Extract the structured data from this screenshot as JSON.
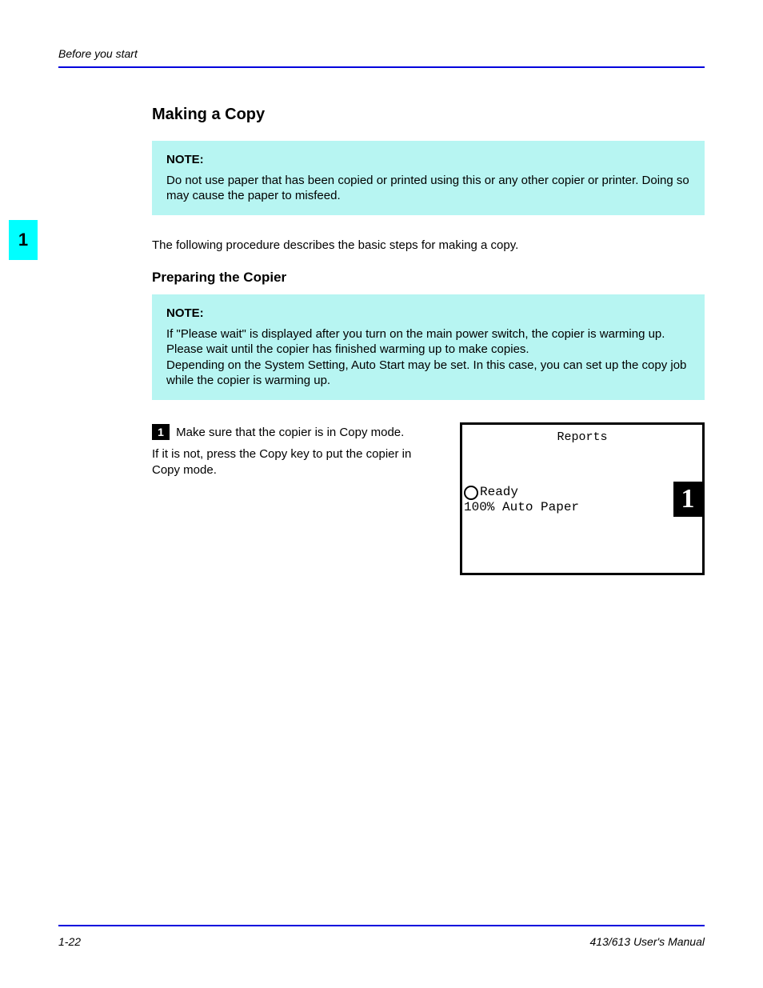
{
  "header": {
    "section_label": "Before you start"
  },
  "side_tab": {
    "label": "1"
  },
  "main": {
    "title": "Making a Copy",
    "note1": {
      "title": "NOTE:",
      "body": "Do not use paper that has been copied or printed using this or any other copier or printer. Doing so may cause the paper to misfeed."
    },
    "intro": "The following procedure describes the basic steps for making a copy.",
    "subtitle": "Preparing the Copier",
    "note2": {
      "title": "NOTE:",
      "body_a": "If \"Please wait\" is displayed after you turn on the main power switch, the copier is warming up. Please wait until the copier has finished warming up to make copies.",
      "body_b": "Depending on the System Setting, Auto Start may be set. In this case, you can set up the copy job while the copier is warming up."
    },
    "step": {
      "num": "1",
      "text_a": "Make sure that the copier is in Copy mode.",
      "text_b": "If it is not, press the Copy key to put the copier in Copy mode."
    },
    "display": {
      "report_title": "Reports",
      "status_line1": "Ready",
      "status_line2": "100% Auto Paper",
      "copy_count": "1"
    }
  },
  "footer": {
    "page_number": "1-22",
    "manual_title": "413/613 User's Manual"
  }
}
